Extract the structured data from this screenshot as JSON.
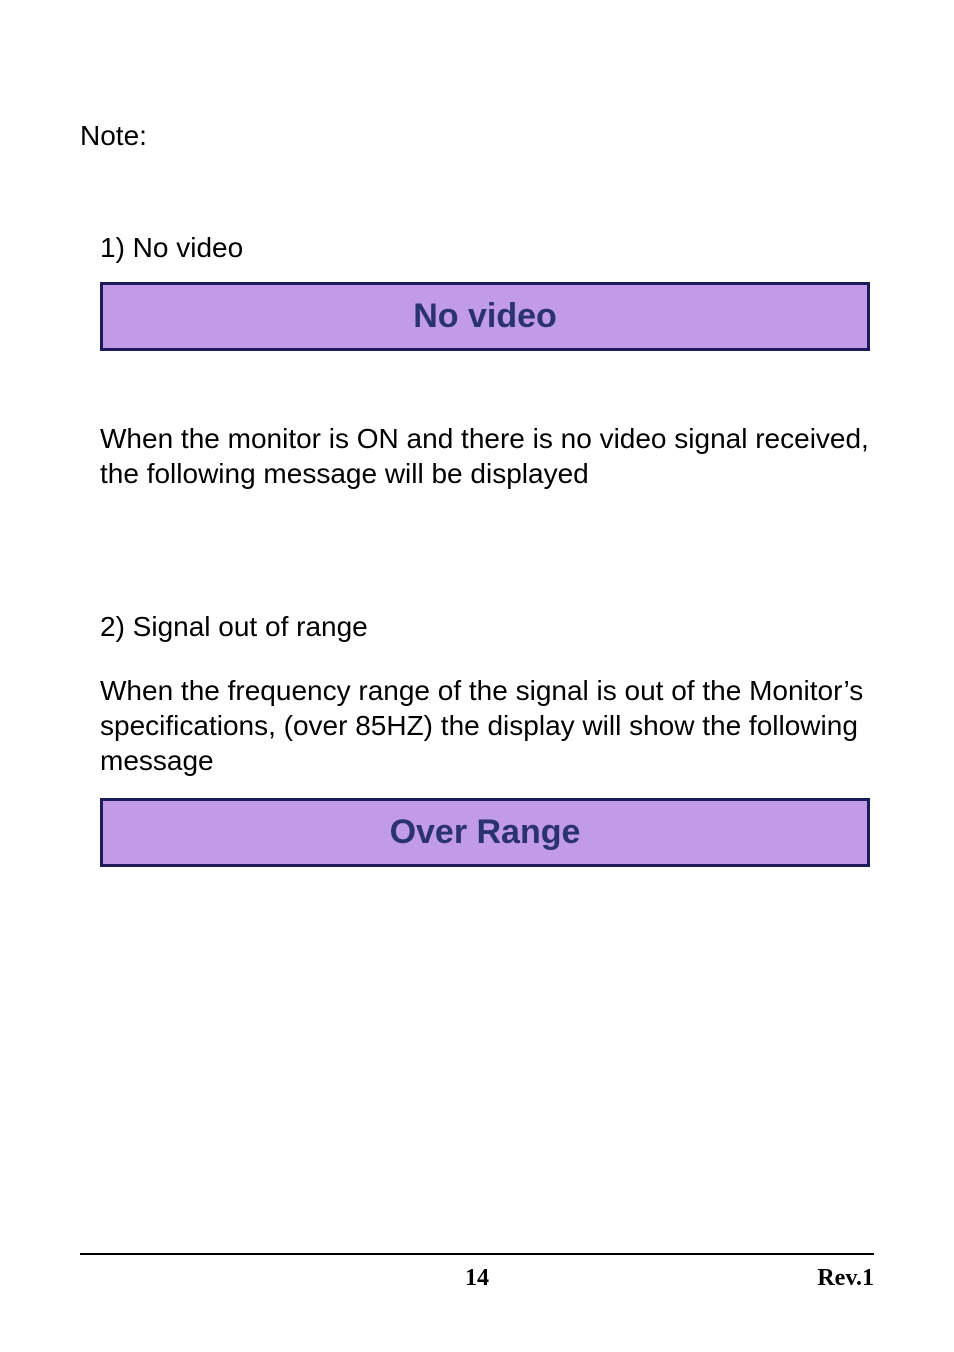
{
  "note_label": "Note:",
  "section1": {
    "heading": "1) No video",
    "message": "No video",
    "paragraph": "When the monitor is ON and there is no video signal received, the following message will be displayed"
  },
  "section2": {
    "heading": "2) Signal out of range",
    "paragraph": "When the frequency range of the signal is out of the Monitor’s specifications, (over 85HZ) the display will show the following message",
    "message": "Over  Range"
  },
  "footer": {
    "page_number": "14",
    "revision": "Rev.1"
  },
  "colors": {
    "box_bg": "#c19be5",
    "box_border": "#1c1c5c",
    "box_text": "#2a336b"
  }
}
